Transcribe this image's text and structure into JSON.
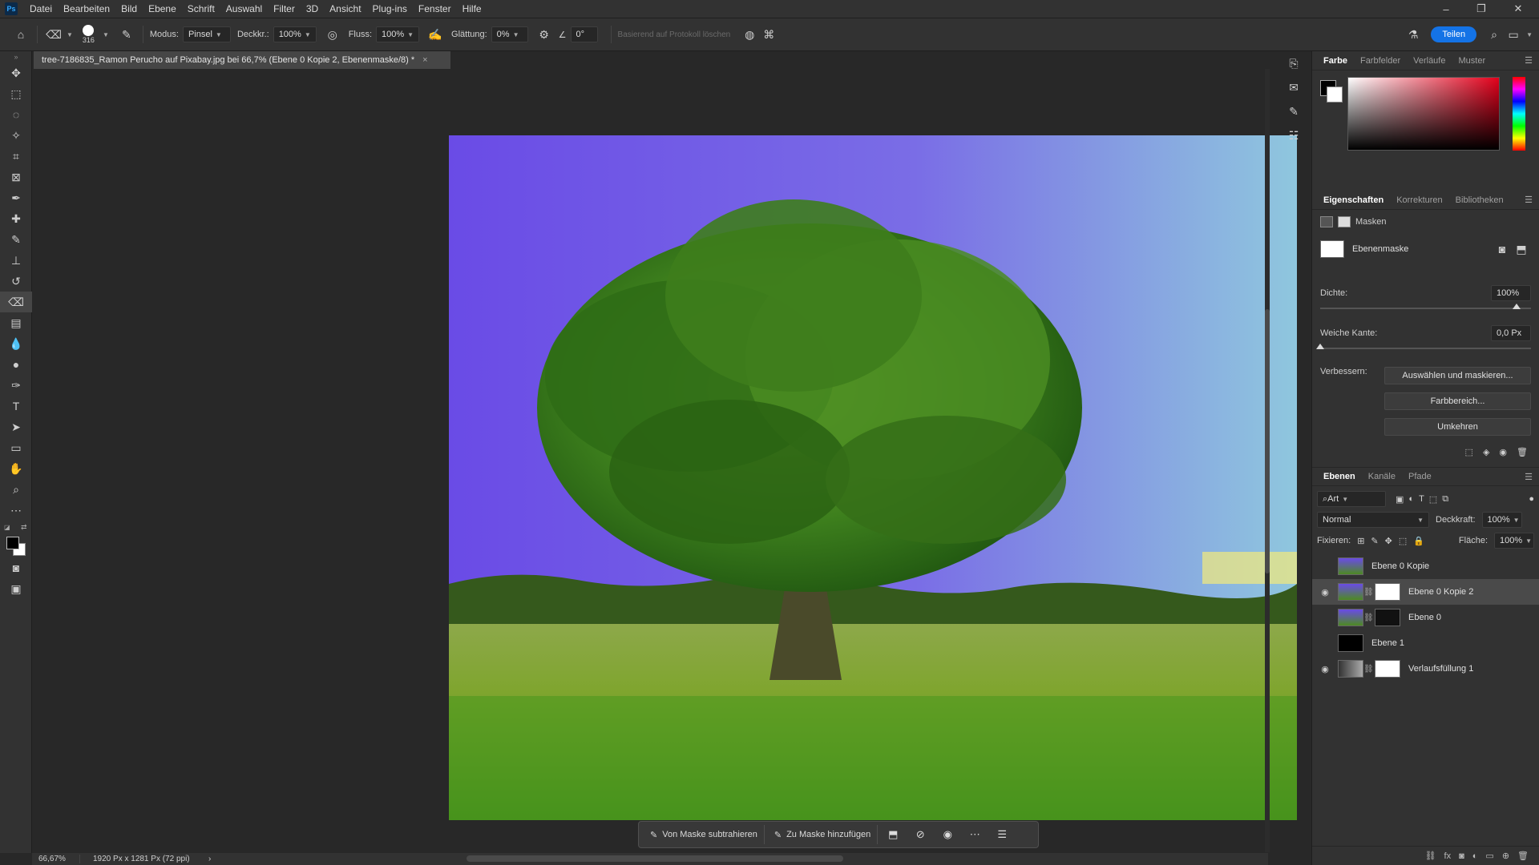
{
  "menubar": {
    "app_logo": "Ps",
    "items": [
      "Datei",
      "Bearbeiten",
      "Bild",
      "Ebene",
      "Schrift",
      "Auswahl",
      "Filter",
      "3D",
      "Ansicht",
      "Plug-ins",
      "Fenster",
      "Hilfe"
    ],
    "window_controls": {
      "minimize": "–",
      "maximize": "❐",
      "close": "✕"
    }
  },
  "options": {
    "brush_size": "316",
    "mode_label": "Modus:",
    "mode_value": "Pinsel",
    "opacity_label": "Deckkr.:",
    "opacity_value": "100%",
    "flow_label": "Fluss:",
    "flow_value": "100%",
    "smoothing_label": "Glättung:",
    "smoothing_value": "0%",
    "angle_value": "0°",
    "history_erase": "Basierend auf Protokoll löschen",
    "share_label": "Teilen"
  },
  "document": {
    "tab_title": "tree-7186835_Ramon Perucho auf Pixabay.jpg bei 66,7% (Ebene 0 Kopie 2, Ebenenmaske/8) *",
    "close": "×"
  },
  "contextbar": {
    "subtract_label": "Von Maske subtrahieren",
    "add_label": "Zu Maske hinzufügen"
  },
  "status": {
    "zoom": "66,67%",
    "dimensions": "1920 Px x 1281 Px (72 ppi)",
    "arrow": "›"
  },
  "color_panel": {
    "tabs": [
      "Farbe",
      "Farbfelder",
      "Verläufe",
      "Muster"
    ],
    "foreground": "#000000",
    "background": "#ffffff"
  },
  "properties_panel": {
    "tabs": [
      "Eigenschaften",
      "Korrekturen",
      "Bibliotheken"
    ],
    "masks_label": "Masken",
    "layer_mask_label": "Ebenenmaske",
    "density_label": "Dichte:",
    "density_value": "100%",
    "feather_label": "Weiche Kante:",
    "feather_value": "0,0 Px",
    "refine_label": "Verbessern:",
    "select_mask_button": "Auswählen und maskieren...",
    "color_range_button": "Farbbereich...",
    "invert_button": "Umkehren"
  },
  "layers_panel": {
    "tabs": [
      "Ebenen",
      "Kanäle",
      "Pfade"
    ],
    "filter_kind": "Art",
    "blend_mode": "Normal",
    "opacity_label": "Deckkraft:",
    "opacity_value": "100%",
    "lock_label": "Fixieren:",
    "fill_label": "Fläche:",
    "fill_value": "100%",
    "layers": [
      {
        "name": "Ebene 0 Kopie",
        "visible": false,
        "has_mask": false,
        "selected": false
      },
      {
        "name": "Ebene 0 Kopie 2",
        "visible": true,
        "has_mask": true,
        "selected": true
      },
      {
        "name": "Ebene 0",
        "visible": false,
        "has_mask": true,
        "selected": false
      },
      {
        "name": "Ebene 1",
        "visible": false,
        "has_mask": false,
        "selected": false
      },
      {
        "name": "Verlaufsfüllung 1",
        "visible": true,
        "has_mask": true,
        "selected": false
      }
    ]
  }
}
